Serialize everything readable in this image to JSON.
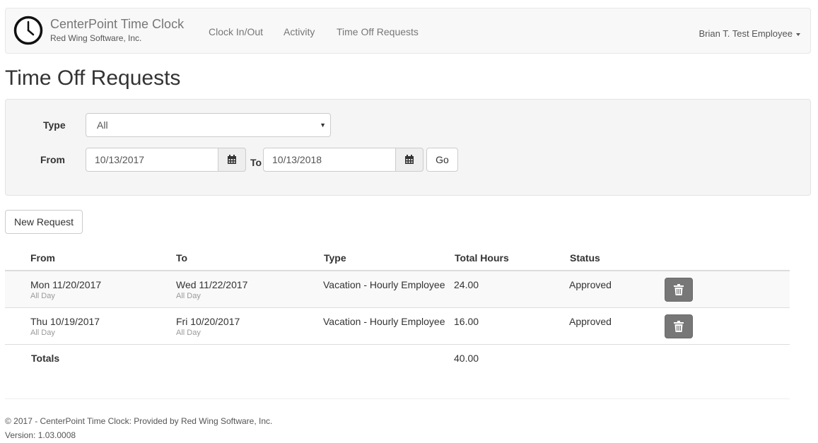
{
  "brand": {
    "title": "CenterPoint Time Clock",
    "subtitle": "Red Wing Software, Inc."
  },
  "nav": {
    "items": [
      "Clock In/Out",
      "Activity",
      "Time Off Requests"
    ],
    "user": "Brian T. Test Employee"
  },
  "page_title": "Time Off Requests",
  "filter": {
    "type_label": "Type",
    "type_value": "All",
    "from_label": "From",
    "from_value": "10/13/2017",
    "to_label": "To",
    "to_value": "10/13/2018",
    "go_label": "Go"
  },
  "new_request_label": "New Request",
  "table": {
    "headers": [
      "From",
      "To",
      "Type",
      "Total Hours",
      "Status"
    ],
    "rows": [
      {
        "from": "Mon 11/20/2017",
        "from_sub": "All Day",
        "to": "Wed 11/22/2017",
        "to_sub": "All Day",
        "type": "Vacation - Hourly Employee",
        "hours": "24.00",
        "status": "Approved"
      },
      {
        "from": "Thu 10/19/2017",
        "from_sub": "All Day",
        "to": "Fri 10/20/2017",
        "to_sub": "All Day",
        "type": "Vacation - Hourly Employee",
        "hours": "16.00",
        "status": "Approved"
      }
    ],
    "totals_label": "Totals",
    "totals_value": "40.00"
  },
  "footer": {
    "copyright": "© 2017 - CenterPoint Time Clock: Provided by Red Wing Software, Inc.",
    "version": "Version: 1.03.0008"
  },
  "colors": {
    "delete_button": "#777777",
    "navbar_bg": "#f8f8f8",
    "panel_bg": "#f5f5f5"
  }
}
